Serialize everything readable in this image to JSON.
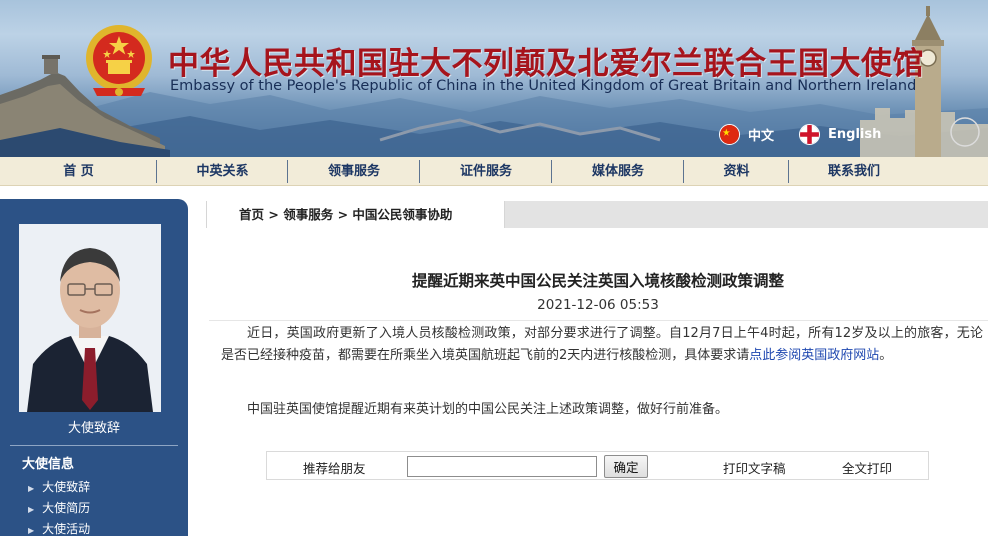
{
  "header": {
    "title_cn": "中华人民共和国驻大不列颠及北爱尔兰联合王国大使馆",
    "title_en": "Embassy of the People's Republic of China in the United Kingdom of Great Britain and Northern Ireland",
    "lang_cn": "中文",
    "lang_en": "English"
  },
  "nav": [
    {
      "label": "首 页"
    },
    {
      "label": "中英关系"
    },
    {
      "label": "领事服务"
    },
    {
      "label": "证件服务"
    },
    {
      "label": "媒体服务"
    },
    {
      "label": "资料"
    },
    {
      "label": "联系我们"
    }
  ],
  "sidebar": {
    "photo_caption": "大使致辞",
    "section_title": "大使信息",
    "items": [
      {
        "label": "大使致辞"
      },
      {
        "label": "大使简历"
      },
      {
        "label": "大使活动"
      }
    ]
  },
  "breadcrumb": {
    "home": "首页",
    "sep1": " > ",
    "level1": "领事服务",
    "sep2": " > ",
    "level2": "中国公民领事协助"
  },
  "article": {
    "title": "提醒近期来英中国公民关注英国入境核酸检测政策调整",
    "date": "2021-12-06 05:53",
    "para1_text": "近日，英国政府更新了入境人员核酸检测政策，对部分要求进行了调整。自12月7日上午4时起，所有12岁及以上的旅客，无论是否已经接种疫苗，都需要在所乘坐入境英国航班起飞前的2天内进行核酸检测，具体要求请",
    "para1_link": "点此参阅英国政府网站",
    "para1_end": "。",
    "para2": "中国驻英国使馆提醒近期有来英计划的中国公民关注上述政策调整，做好行前准备。"
  },
  "share": {
    "label": "推荐给朋友",
    "input_value": "",
    "confirm": "确定",
    "print_text": "打印文字稿",
    "print_all": "全文打印"
  },
  "colors": {
    "title_red": "#a6141c",
    "nav_text": "#1d3764",
    "sidebar_bg": "#2c5286",
    "nav_bg": "#f2ecd9",
    "link_blue": "#1f48b0"
  }
}
